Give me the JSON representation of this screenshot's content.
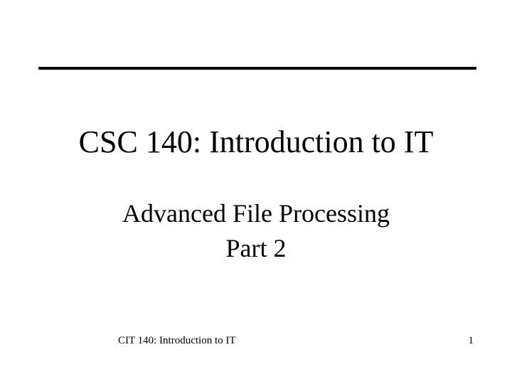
{
  "title": "CSC 140: Introduction to IT",
  "subtitle_line1": "Advanced File Processing",
  "subtitle_line2": "Part 2",
  "footer_left": "CIT 140: Introduction to IT",
  "footer_right": "1"
}
